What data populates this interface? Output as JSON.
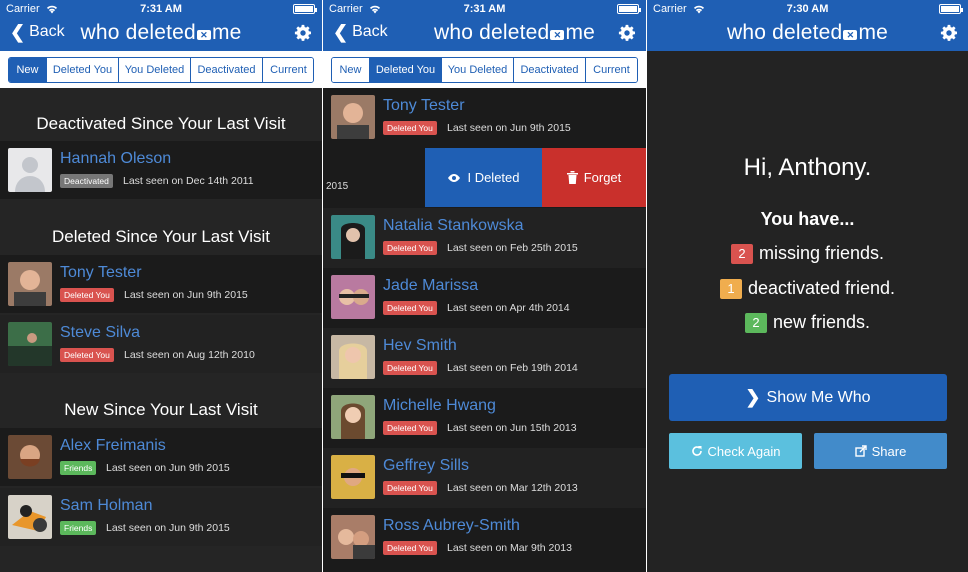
{
  "status": {
    "carrier": "Carrier",
    "times": [
      "7:31 AM",
      "7:31 AM",
      "7:30 AM"
    ]
  },
  "app": {
    "title_left": "who deleted",
    "title_right": "me",
    "back_label": "Back"
  },
  "tabs": [
    {
      "label": "New"
    },
    {
      "label": "Deleted You"
    },
    {
      "label": "You Deleted"
    },
    {
      "label": "Deactivated"
    },
    {
      "label": "Current"
    }
  ],
  "screen1": {
    "sections": [
      {
        "title": "Deactivated Since Your Last Visit"
      },
      {
        "title": "Deleted Since Your Last Visit"
      },
      {
        "title": "New Since Your Last Visit"
      }
    ],
    "rows": [
      {
        "name": "Hannah Oleson",
        "badge": "Deactivated",
        "seen": "Last seen on Dec 14th 2011"
      },
      {
        "name": "Tony Tester",
        "badge": "Deleted You",
        "seen": "Last seen on Jun 9th 2015"
      },
      {
        "name": "Steve Silva",
        "badge": "Deleted You",
        "seen": "Last seen on Aug 12th 2010"
      },
      {
        "name": "Alex Freimanis",
        "badge": "Friends",
        "seen": "Last seen on Jun 9th 2015"
      },
      {
        "name": "Sam Holman",
        "badge": "Friends",
        "seen": "Last seen on Jun 9th 2015"
      }
    ]
  },
  "screen2": {
    "rows": [
      {
        "name": "Tony Tester",
        "badge": "Deleted You",
        "seen": "Last seen on Jun 9th 2015"
      },
      {
        "name": "Natalia Stankowska",
        "badge": "Deleted You",
        "seen": "Last seen on Feb 25th 2015"
      },
      {
        "name": "Jade Marissa",
        "badge": "Deleted You",
        "seen": "Last seen on Apr 4th 2014"
      },
      {
        "name": "Hev Smith",
        "badge": "Deleted You",
        "seen": "Last seen on Feb 19th 2014"
      },
      {
        "name": "Michelle Hwang",
        "badge": "Deleted You",
        "seen": "Last seen on Jun 15th 2013"
      },
      {
        "name": "Geffrey Sills",
        "badge": "Deleted You",
        "seen": "Last seen on Mar 12th 2013"
      },
      {
        "name": "Ross Aubrey-Smith",
        "badge": "Deleted You",
        "seen": "Last seen on Mar 9th 2013"
      }
    ],
    "swipe_fragment": "2015",
    "action_ideleted": "I Deleted",
    "action_forget": "Forget"
  },
  "screen3": {
    "greeting": "Hi, Anthony.",
    "you_have": "You have...",
    "stats": [
      {
        "count": "2",
        "text": "missing friends."
      },
      {
        "count": "1",
        "text": "deactivated friend."
      },
      {
        "count": "2",
        "text": "new friends."
      }
    ],
    "show_button": "Show Me Who",
    "check_button": "Check Again",
    "share_button": "Share"
  },
  "colors": {
    "brand": "#1f5fb4",
    "danger": "#d9534f",
    "warning": "#f0ad4e",
    "success": "#5cb85c",
    "info": "#5bc0de"
  }
}
